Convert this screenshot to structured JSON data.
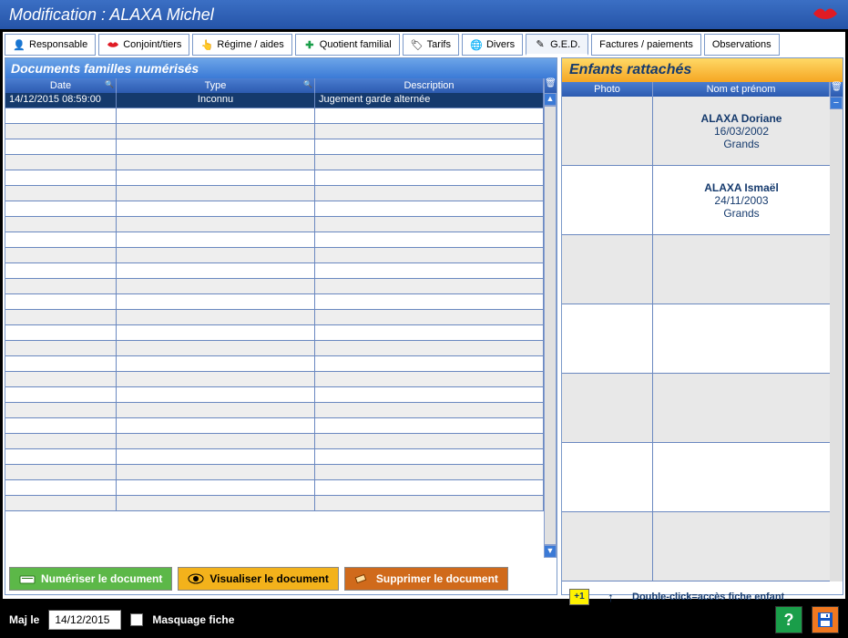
{
  "titlebar": "Modification : ALAXA Michel",
  "tabs": [
    {
      "label": "Responsable"
    },
    {
      "label": "Conjoint/tiers"
    },
    {
      "label": "Régime / aides"
    },
    {
      "label": "Quotient familial"
    },
    {
      "label": "Tarifs"
    },
    {
      "label": "Divers"
    },
    {
      "label": "G.E.D."
    },
    {
      "label": "Factures / paiements"
    },
    {
      "label": "Observations"
    }
  ],
  "documents": {
    "title": "Documents familles numérisés",
    "headers": {
      "date": "Date",
      "type": "Type",
      "description": "Description"
    },
    "rows": [
      {
        "date": "14/12/2015 08:59:00",
        "type": "Inconnu",
        "description": "Jugement garde alternée"
      }
    ]
  },
  "buttons": {
    "scan": "Numériser le document",
    "view": "Visualiser le document",
    "delete": "Supprimer le document"
  },
  "children": {
    "title": "Enfants rattachés",
    "headers": {
      "photo": "Photo",
      "name": "Nom et prénom"
    },
    "rows": [
      {
        "name": "ALAXA Doriane",
        "date": "16/03/2002",
        "group": "Grands"
      },
      {
        "name": "ALAXA Ismaël",
        "date": "24/11/2003",
        "group": "Grands"
      }
    ],
    "hint": "Double-click=accès fiche enfant",
    "add_symbol": "+1"
  },
  "bottom": {
    "maj_label": "Maj le",
    "maj_date": "14/12/2015",
    "mask_label": "Masquage fiche",
    "help": "?"
  },
  "arrow": "↑"
}
